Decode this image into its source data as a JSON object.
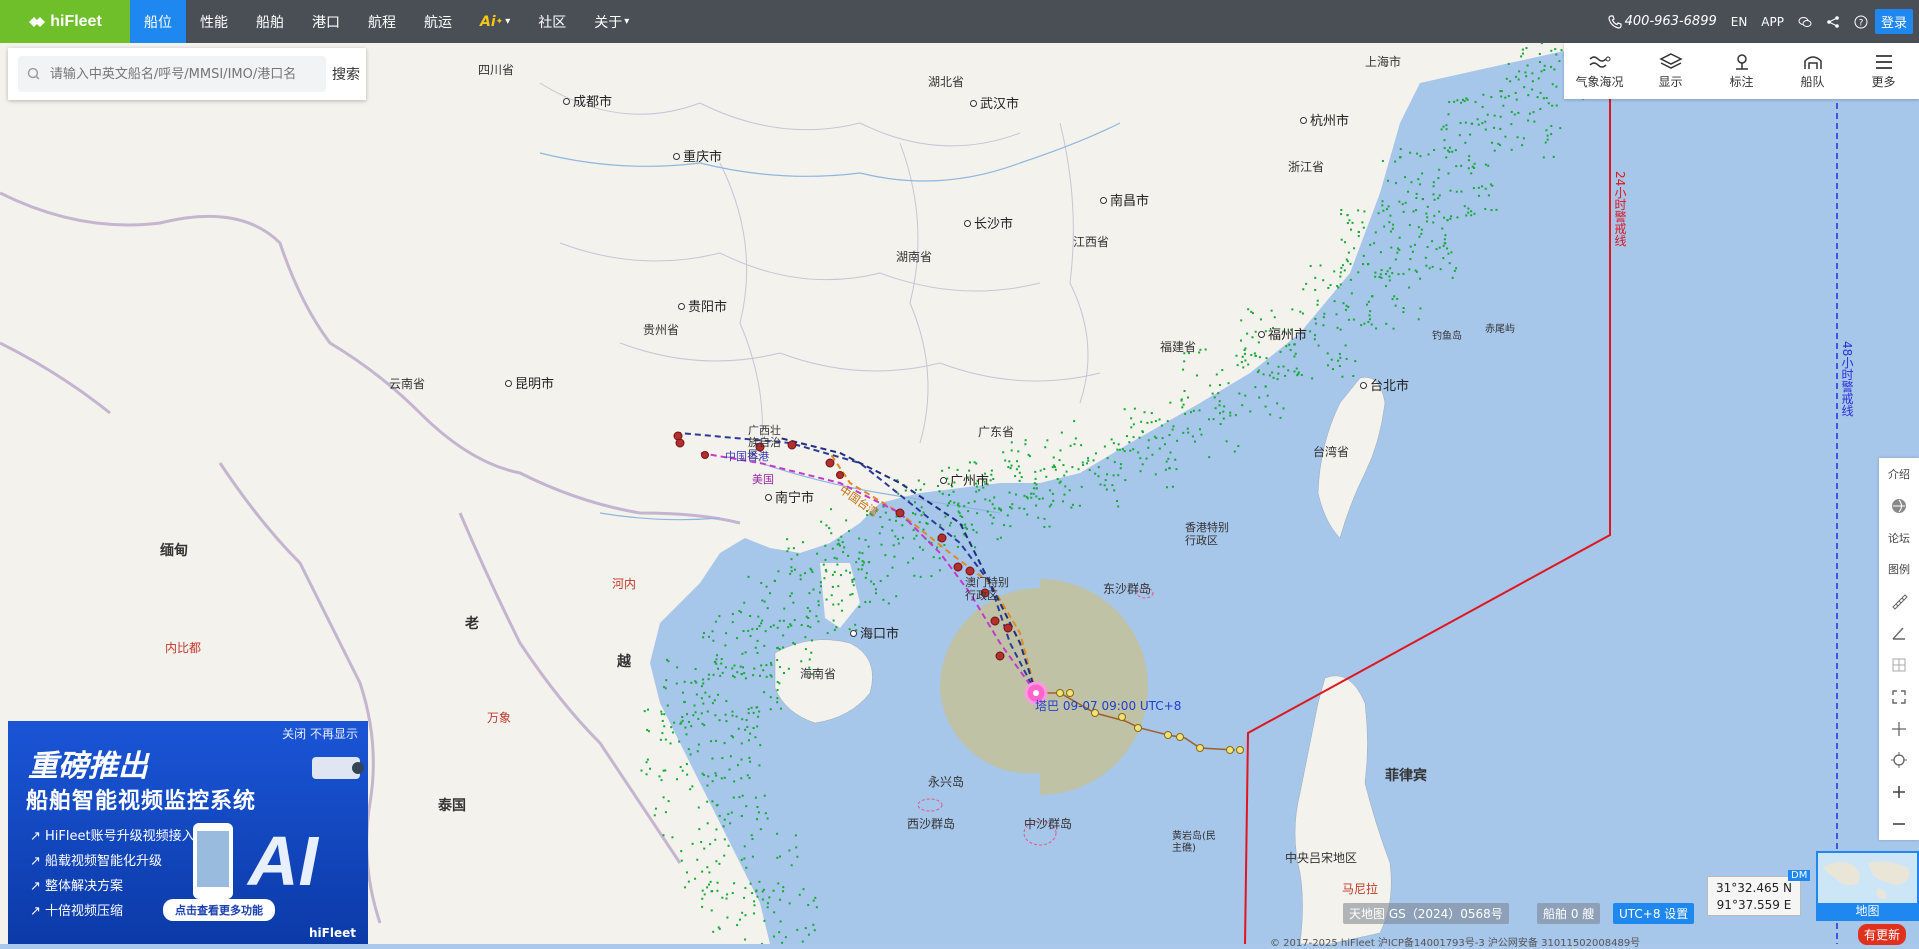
{
  "topnav": {
    "logo": "hiFleet",
    "items": [
      {
        "label": "船位",
        "active": true
      },
      {
        "label": "性能"
      },
      {
        "label": "船舶"
      },
      {
        "label": "港口"
      },
      {
        "label": "航程"
      },
      {
        "label": "航运"
      },
      {
        "label": "Ai"
      },
      {
        "label": "社区"
      },
      {
        "label": "关于"
      }
    ],
    "phone": "400-963-6899",
    "lang": "EN",
    "app": "APP",
    "login": "登录"
  },
  "search": {
    "placeholder": "请输入中英文船名/呼号/MMSI/IMO/港口名",
    "button": "搜索"
  },
  "toolbar": {
    "items": [
      {
        "label": "气象海况",
        "icon": "weather-icon"
      },
      {
        "label": "显示",
        "icon": "layers-icon"
      },
      {
        "label": "标注",
        "icon": "pin-icon"
      },
      {
        "label": "船队",
        "icon": "fleet-icon"
      },
      {
        "label": "更多",
        "icon": "menu-icon"
      }
    ]
  },
  "sidetools": {
    "items": [
      {
        "label": "介绍"
      },
      {
        "label": "",
        "icon": "satellite-icon"
      },
      {
        "label": "论坛"
      },
      {
        "label": "图例"
      },
      {
        "label": "",
        "icon": "ruler-icon"
      },
      {
        "label": "",
        "icon": "angle-icon"
      },
      {
        "label": "",
        "icon": "grid-icon"
      },
      {
        "label": "",
        "icon": "fullscreen-icon"
      },
      {
        "label": "",
        "icon": "crosshair-icon"
      },
      {
        "label": "",
        "icon": "locate-icon"
      },
      {
        "label": "",
        "icon": "zoom-in-icon"
      },
      {
        "label": "",
        "icon": "zoom-out-icon"
      }
    ]
  },
  "map": {
    "cities": {
      "chengdu": "成都市",
      "chongqing": "重庆市",
      "guiyang": "贵阳市",
      "kunming": "昆明市",
      "changsha": "长沙市",
      "wuhan": "武汉市",
      "nanchang": "南昌市",
      "hangzhou": "杭州市",
      "fuzhou": "福州市",
      "taipei": "台北市",
      "nanning": "南宁市",
      "guangzhou": "广州市",
      "haikou": "海口市"
    },
    "provinces": {
      "sichuan": "四川省",
      "hubei": "湖北省",
      "hunan": "湖南省",
      "jiangxi": "江西省",
      "guizhou": "贵州省",
      "yunnan": "云南省",
      "guangxi": "广西壮族自治区",
      "guangdong": "广东省",
      "fujian": "福建省",
      "zhejiang": "浙江省",
      "taiwan": "台湾省",
      "hainan": "海南省",
      "hk": "香港特别行政区",
      "macau": "澳门特别行政区",
      "shanghai": "上海市"
    },
    "foreign": {
      "laos": "老",
      "vietnam": "越",
      "thailand": "泰国",
      "philippines": "菲律宾",
      "luzon": "中央吕宋地区",
      "burma": "缅甸",
      "hanoi": "河内",
      "naypyidaw": "内比都",
      "vientiane": "万象",
      "manila": "马尼拉"
    },
    "islands": {
      "dongsha": "东沙群岛",
      "xisha": "西沙群岛",
      "zhongsha": "中沙群岛",
      "yongxing": "永兴岛",
      "huangyan": "黄岩岛(民主礁)",
      "diaoyu": "钓鱼岛",
      "chiwei": "赤尾屿"
    },
    "warning_24h": "24小时警戒线",
    "warning_48h": "48小时警戒线",
    "typhoon_label": "塔巴 09-07 09:00 UTC+8",
    "forecast_labels": [
      "中国香港",
      "美国",
      "中国台湾"
    ]
  },
  "ad": {
    "close": "关闭 不再显示",
    "headline": "重磅推出",
    "title": "船舶智能视频监控系统",
    "features": [
      "HiFleet账号升级视频接入",
      "船载视频智能化升级",
      "整体解决方案",
      "十倍视频压缩"
    ],
    "button": "点击查看更多功能",
    "ai": "AI",
    "brand": "hiFleet"
  },
  "status": {
    "map_source": "天地图 GS（2024）0568号",
    "ship_count": "船舶 0 艘",
    "timezone": "UTC+8 设置",
    "lat": "31°32.465 N",
    "lon": "91°37.559 E",
    "dm": "DM",
    "minimap_label": "地图",
    "update": "有更新",
    "copyright": "© 2017-2025 hiFleet 沪ICP备14001793号-3 沪公网安备 31011502008489号"
  },
  "colors": {
    "nav_bg": "#4a4f56",
    "brand_green": "#6fbf2a",
    "accent_blue": "#1e87f0",
    "land": "#f4f2ec",
    "sea": "#a6c6ea",
    "ship_dots": "#17a83a",
    "warning_24h": "#e0151e",
    "warning_48h": "#2a2fd8",
    "typhoon_circle": "#c8c08f"
  }
}
